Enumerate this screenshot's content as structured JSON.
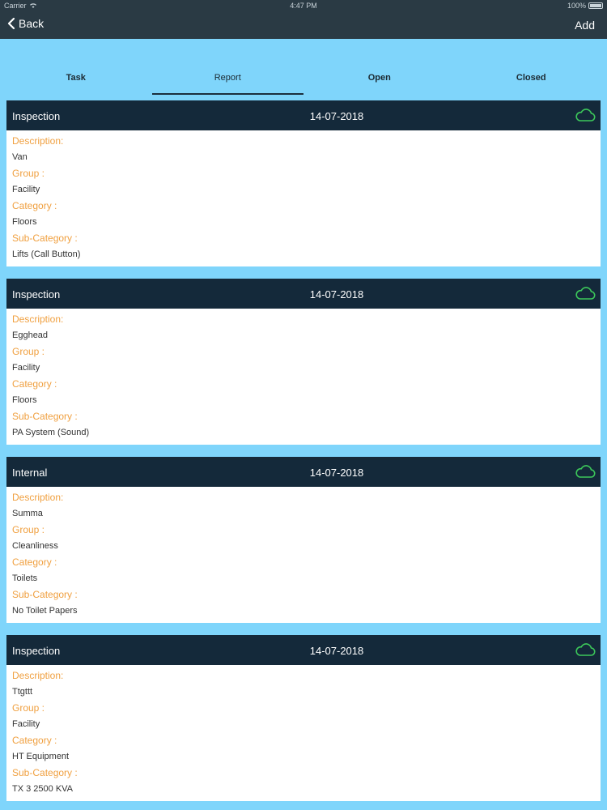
{
  "status_bar": {
    "carrier": "Carrier",
    "time": "4:47 PM",
    "battery": "100%"
  },
  "nav": {
    "back_label": "Back",
    "add_label": "Add"
  },
  "tabs": [
    {
      "label": "Task"
    },
    {
      "label": "Report"
    },
    {
      "label": "Open"
    },
    {
      "label": "Closed"
    }
  ],
  "labels": {
    "description": "Description:",
    "group": "Group :",
    "category": "Category :",
    "sub_category": "Sub-Category :"
  },
  "cards": [
    {
      "type": "Inspection",
      "date": "14-07-2018",
      "description": "Van",
      "group": "Facility",
      "category": "Floors",
      "sub_category": "Lifts (Call Button)"
    },
    {
      "type": "Inspection",
      "date": "14-07-2018",
      "description": "Egghead",
      "group": "Facility",
      "category": "Floors",
      "sub_category": "PA System (Sound)"
    },
    {
      "type": "Internal",
      "date": "14-07-2018",
      "description": "Summa",
      "group": "Cleanliness",
      "category": "Toilets",
      "sub_category": "No Toilet Papers"
    },
    {
      "type": "Inspection",
      "date": "14-07-2018",
      "description": "Ttgttt",
      "group": "Facility",
      "category": "HT Equipment",
      "sub_category": "TX 3 2500 KVA"
    }
  ],
  "colors": {
    "background": "#7fd5fb",
    "nav": "#2a3a44",
    "card_header": "#14293a",
    "label": "#f0a040",
    "cloud": "#3cc85a"
  },
  "icons": {
    "back": "chevron-left-icon",
    "wifi": "wifi-icon",
    "battery": "battery-icon",
    "cloud": "cloud-icon"
  }
}
